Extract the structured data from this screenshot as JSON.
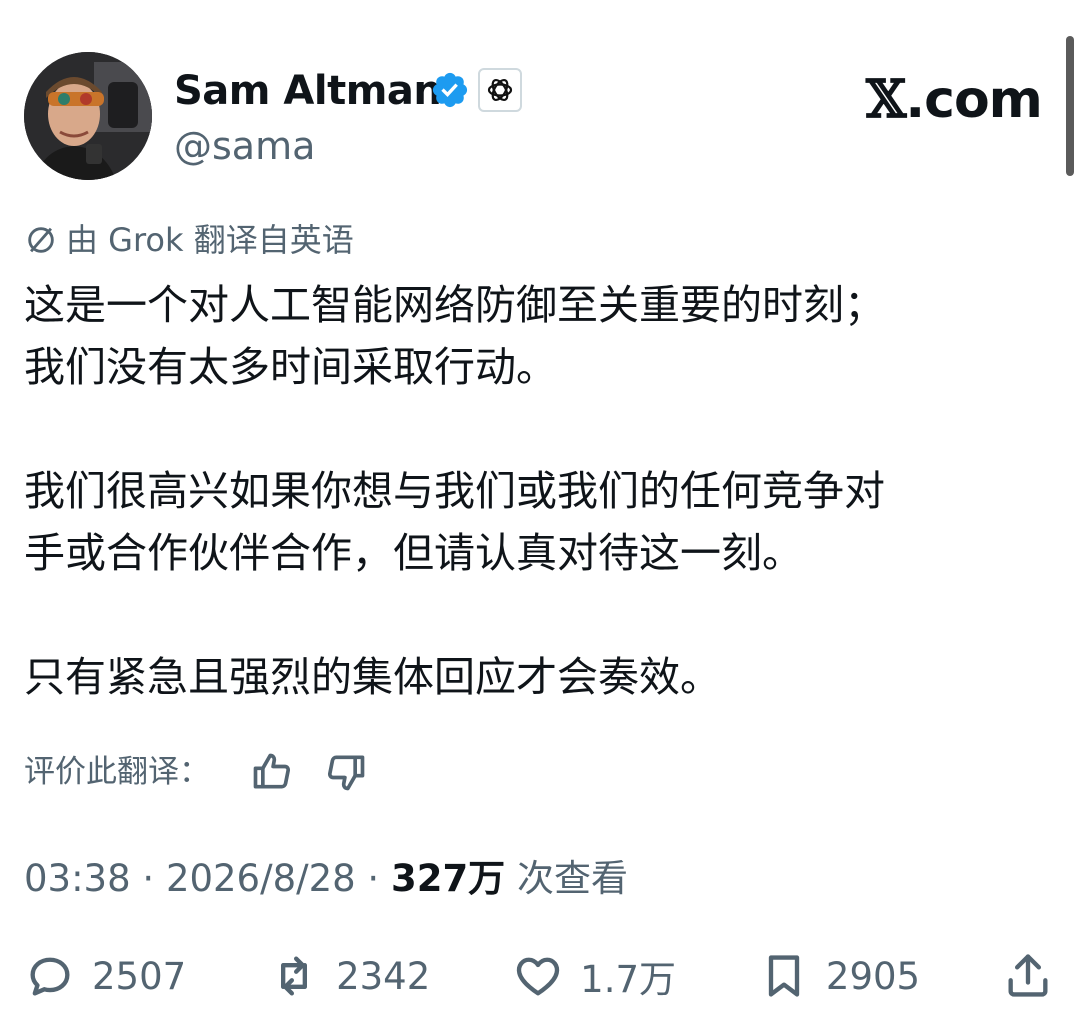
{
  "author": {
    "display_name": "Sam Altman",
    "handle": "@sama",
    "verified_icon": "verified-badge-icon",
    "org_badge_icon": "openai-logo-icon"
  },
  "site_logo": {
    "x": "𝕏",
    "suffix": ".com"
  },
  "translation": {
    "icon": "globe-slash-icon",
    "label": "由 Grok 翻译自英语",
    "rate_label": "评价此翻译：",
    "like_icon": "thumbs-up-icon",
    "dislike_icon": "thumbs-down-icon"
  },
  "tweet": {
    "paragraphs": [
      "这是一个对人工智能网络防御至关重要的时刻；\n我们没有太多时间采取行动。",
      "我们很高兴如果你想与我们或我们的任何竞争对\n手或合作伙伴合作，但请认真对待这一刻。",
      "只有紧急且强烈的集体回应才会奏效。"
    ]
  },
  "meta": {
    "time": "03:38",
    "date": "2026/8/28",
    "separator": "·",
    "views_count": "327万",
    "views_label": "次查看"
  },
  "actions": {
    "replies": "2507",
    "reposts": "2342",
    "likes": "1.7万",
    "bookmarks": "2905"
  },
  "colors": {
    "text": "#0f1419",
    "secondary": "#536471",
    "verified_blue": "#1d9bf0"
  }
}
